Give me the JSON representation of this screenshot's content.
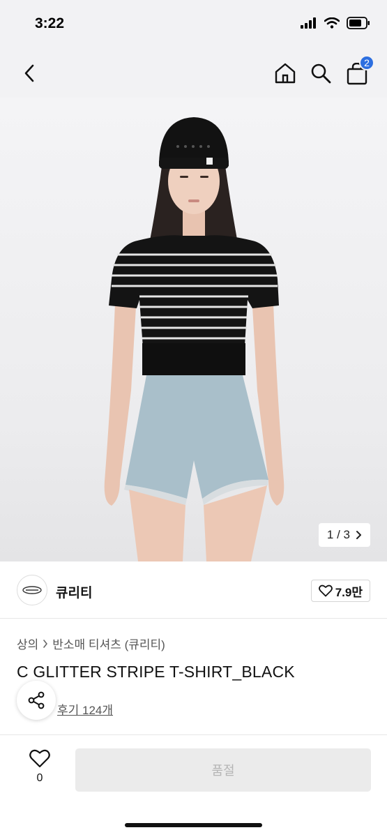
{
  "status_bar": {
    "time": "3:22"
  },
  "nav": {
    "cart_count": "2"
  },
  "colors": {
    "accent": "#2d6fe0",
    "soldout_bg": "#ebebeb",
    "soldout_text": "#b5b5b5"
  },
  "gallery": {
    "current": "1",
    "separator": "/",
    "total": "3"
  },
  "brand": {
    "name": "큐리티",
    "likes": "7.9만"
  },
  "breadcrumb": {
    "category": "상의",
    "subcategory": "반소매 티셔츠 (큐리티)"
  },
  "product": {
    "title": "C GLITTER STRIPE T-SHIRT_BLACK",
    "review_link": "후기 124개"
  },
  "bottom": {
    "wish_count": "0",
    "buy_label": "품절"
  },
  "icons": [
    "back-arrow-icon",
    "home-icon",
    "search-icon",
    "shopping-bag-icon",
    "chevron-right-icon",
    "heart-icon",
    "share-icon"
  ]
}
